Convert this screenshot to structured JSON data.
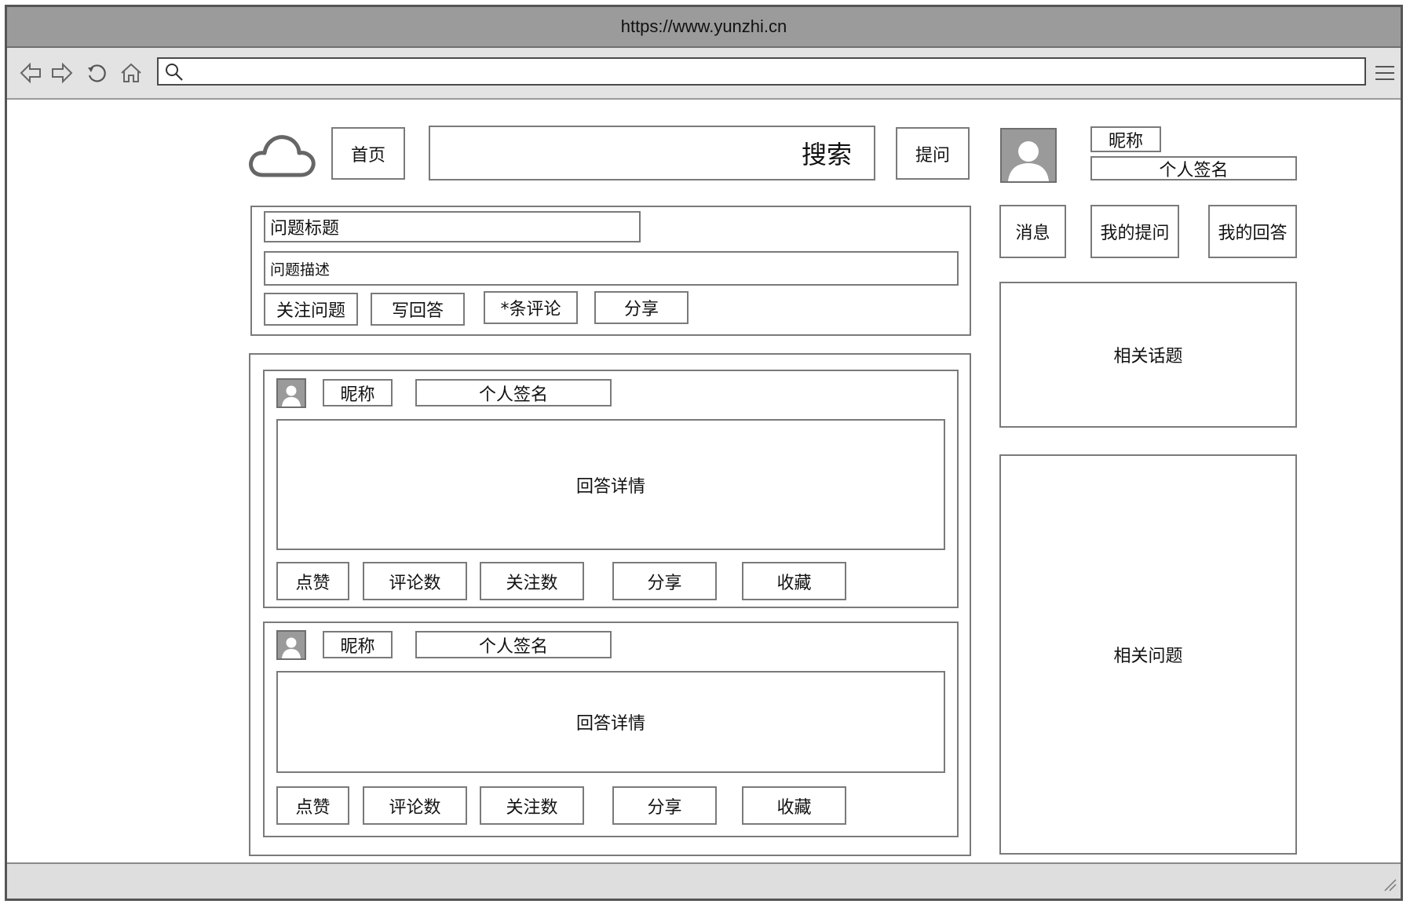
{
  "browser": {
    "url": "https://www.yunzhi.cn",
    "icons": [
      "back-arrow-icon",
      "forward-arrow-icon",
      "reload-icon",
      "home-icon",
      "search-icon",
      "menu-icon",
      "resize-grip-icon"
    ]
  },
  "header": {
    "logo_icon": "cloud-icon",
    "home_label": "首页",
    "search_label": "搜索",
    "ask_label": "提问"
  },
  "user": {
    "avatar_icon": "user-avatar-icon",
    "nickname": "昵称",
    "signature": "个人签名",
    "nav": [
      "消息",
      "我的提问",
      "我的回答"
    ]
  },
  "question": {
    "title": "问题标题",
    "description": "问题描述",
    "actions": [
      "关注问题",
      "写回答",
      "*条评论",
      "分享"
    ]
  },
  "answers": [
    {
      "nickname": "昵称",
      "signature": "个人签名",
      "detail": "回答详情",
      "actions": [
        "点赞",
        "评论数",
        "关注数",
        "分享",
        "收藏"
      ]
    },
    {
      "nickname": "昵称",
      "signature": "个人签名",
      "detail": "回答详情",
      "actions": [
        "点赞",
        "评论数",
        "关注数",
        "分享",
        "收藏"
      ]
    }
  ],
  "sidebar": {
    "related_topics": "相关话题",
    "related_questions": "相关问题"
  },
  "colors": {
    "titlebar": "#9b9b9b",
    "toolbar": "#e3e3e3",
    "border": "#7a7a7a",
    "avatar": "#9a9a9a"
  }
}
